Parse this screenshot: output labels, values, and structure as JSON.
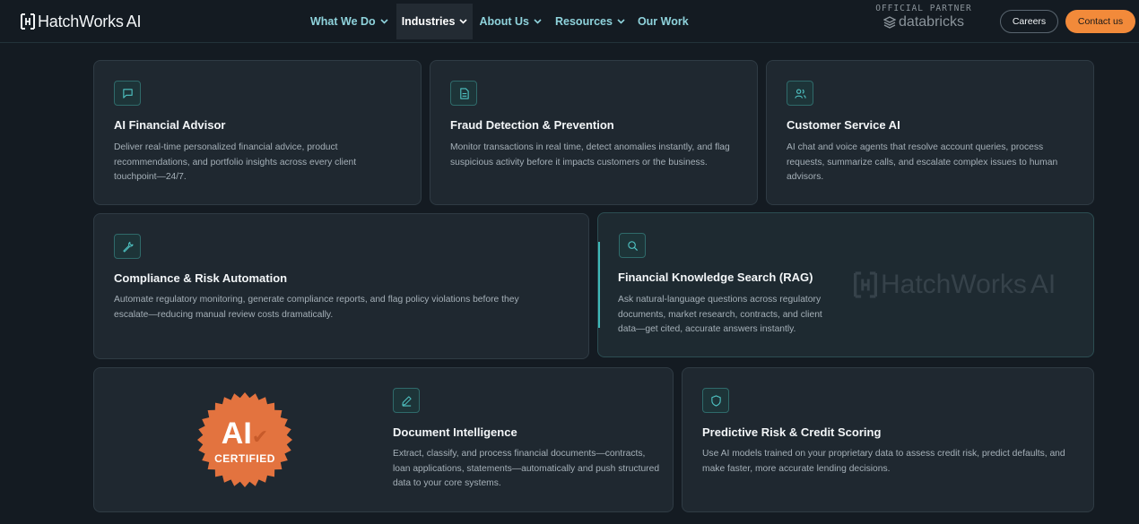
{
  "nav": {
    "logo_text": "HatchWorks",
    "logo_ai": "AI",
    "menu": [
      {
        "label": "What We Do"
      },
      {
        "label": "Industries"
      },
      {
        "label": "About Us"
      },
      {
        "label": "Resources"
      },
      {
        "label": "Our Work"
      }
    ],
    "partner_label": "OFFICIAL PARTNER",
    "partner_brand": "databricks",
    "careers_label": "Careers",
    "contact_label": "Contact us"
  },
  "cards": [
    {
      "title": "AI Financial Advisor",
      "desc": "Deliver real-time personalized financial advice, product recommendations, and portfolio insights across every client touchpoint—24/7.",
      "icon": "chat-icon"
    },
    {
      "title": "Fraud Detection & Prevention",
      "desc": "Monitor transactions in real time, detect anomalies instantly, and flag suspicious activity before it impacts customers or the business.",
      "icon": "document-icon"
    },
    {
      "title": "Customer Service AI",
      "desc": "AI chat and voice agents that resolve account queries, process requests, summarize calls, and escalate complex issues to human advisors.",
      "icon": "users-icon"
    },
    {
      "title": "Compliance & Risk Automation",
      "desc": "Automate regulatory monitoring, generate compliance reports, and flag policy violations before they escalate—reducing manual review costs dramatically.",
      "icon": "wrench-icon"
    },
    {
      "title": "Financial Knowledge Search (RAG)",
      "desc": "Ask natural-language questions across regulatory documents, market research, contracts, and client data—get cited, accurate answers instantly.",
      "icon": "search-icon"
    },
    {
      "title": "Document Intelligence",
      "desc": "Extract, classify, and process financial documents—contracts, loan applications, statements—automatically and push structured data to your core systems.",
      "icon": "pen-icon"
    },
    {
      "title": "Predictive Risk & Credit Scoring",
      "desc": "Use AI models trained on your proprietary data to assess credit risk, predict defaults, and make faster, more accurate lending decisions.",
      "icon": "shield-icon"
    }
  ],
  "watermark": {
    "text": "HatchWorks",
    "ai": "AI"
  },
  "badge": {
    "ai": "AI",
    "certified": "CERTIFIED"
  },
  "colors": {
    "accent": "#3fb8b8",
    "contact_button": "#f28a3a",
    "badge": "#e3733f",
    "menu_link": "#8fd3dc"
  }
}
